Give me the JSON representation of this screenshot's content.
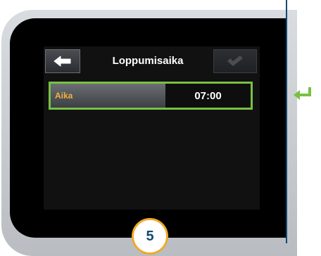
{
  "screen": {
    "title": "Loppumisaika",
    "back_icon": "arrow-left-icon",
    "confirm_icon": "checkmark-icon",
    "field": {
      "label": "Aika",
      "value": "07:00"
    }
  },
  "annotations": {
    "step_number": "5",
    "enter_icon": "enter-return-icon"
  },
  "colors": {
    "accent_green": "#7ac043",
    "label_orange": "#f3b13a",
    "badge_border": "#f0a92b",
    "brand_blue": "#17496f"
  }
}
